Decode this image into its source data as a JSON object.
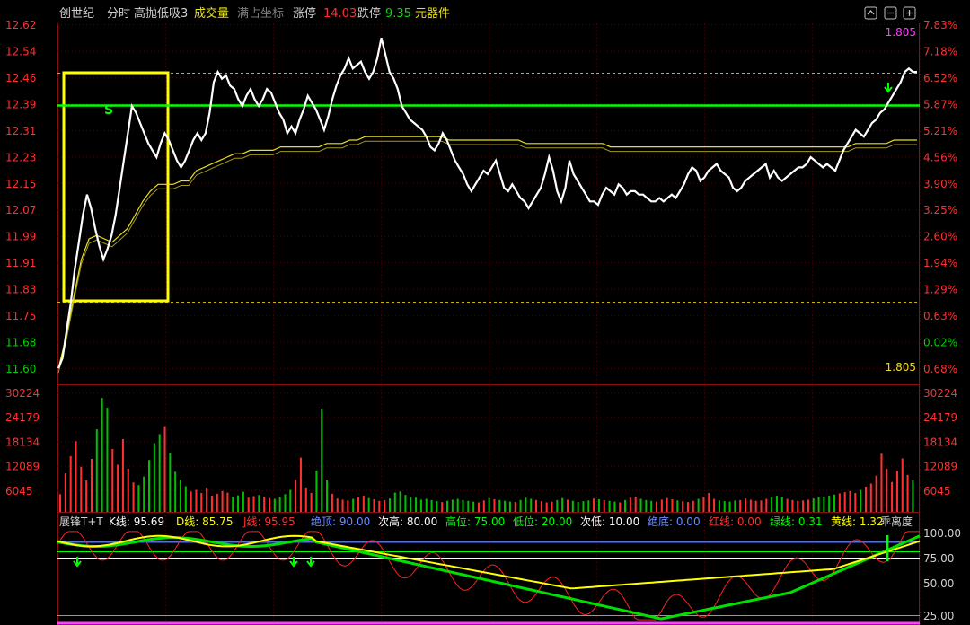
{
  "header": {
    "stock_name": "创世纪",
    "mode_label": "分时",
    "indicator_label": "高抛低吸3",
    "volume_label": "成交量",
    "coord_label": "满占坐标",
    "limit_up_label": "涨停",
    "limit_up_value": "14.03",
    "limit_down_label": "跌停",
    "limit_down_value": "9.35",
    "sector_label": "元器件",
    "icons": [
      "expand-icon",
      "minus-icon",
      "plus-icon"
    ]
  },
  "price_axis": {
    "left_ticks": [
      "12.62",
      "12.54",
      "12.46",
      "12.39",
      "12.31",
      "12.23",
      "12.15",
      "12.07",
      "11.99",
      "11.91",
      "11.83",
      "11.75",
      "11.68",
      "11.60"
    ],
    "right_ticks": [
      "7.83%",
      "7.18%",
      "6.52%",
      "5.87%",
      "5.21%",
      "4.56%",
      "3.90%",
      "3.25%",
      "2.60%",
      "1.94%",
      "1.29%",
      "0.63%",
      "0.02%",
      "0.68%"
    ],
    "top_right_value": "1.805",
    "bottom_right_value": "1.805"
  },
  "volume_axis": {
    "ticks": [
      "30224",
      "24179",
      "18134",
      "12089",
      "6045"
    ]
  },
  "indicator_bar": {
    "name": "展锋T+T",
    "items": [
      {
        "label": "K线:",
        "value": "95.69",
        "color": "#ffffff"
      },
      {
        "label": "D线:",
        "value": "85.75",
        "color": "#ffff00"
      },
      {
        "label": "J线:",
        "value": "95.95",
        "color": "#ff3030"
      },
      {
        "label": "绝顶:",
        "value": "90.00",
        "color": "#6a8cff"
      },
      {
        "label": "次高:",
        "value": "80.00",
        "color": "#ffffff"
      },
      {
        "label": "高位:",
        "value": "75.00",
        "color": "#00ff00"
      },
      {
        "label": "低位:",
        "value": "20.00",
        "color": "#00ff00"
      },
      {
        "label": "次低:",
        "value": "10.00",
        "color": "#ffffff"
      },
      {
        "label": "绝底:",
        "value": "0.00",
        "color": "#6a8cff"
      },
      {
        "label": "红线:",
        "value": "0.00",
        "color": "#ff3030"
      },
      {
        "label": "绿线:",
        "value": "0.31",
        "color": "#00ff00"
      },
      {
        "label": "黄线:",
        "value": "1.32",
        "color": "#ffff00"
      }
    ],
    "trailing_label": "乖离度"
  },
  "indicator_axis": {
    "ticks": [
      "100.00",
      "75.00",
      "50.00",
      "25.00"
    ]
  },
  "colors": {
    "up": "#ff3030",
    "down": "#00e000",
    "price_line": "#ffffff",
    "avg_line": "#e8e020",
    "box": "#ffff00",
    "support_line": "#00ff00"
  },
  "chart_data": {
    "type": "line",
    "price": [
      11.61,
      11.64,
      11.72,
      11.8,
      11.9,
      11.98,
      12.06,
      12.12,
      12.08,
      12.02,
      11.97,
      11.93,
      11.96,
      12.0,
      12.06,
      12.14,
      12.22,
      12.3,
      12.38,
      12.36,
      12.33,
      12.3,
      12.27,
      12.25,
      12.23,
      12.27,
      12.3,
      12.28,
      12.25,
      12.22,
      12.2,
      12.22,
      12.25,
      12.28,
      12.3,
      12.28,
      12.3,
      12.36,
      12.45,
      12.48,
      12.46,
      12.47,
      12.44,
      12.43,
      12.4,
      12.38,
      12.41,
      12.43,
      12.4,
      12.38,
      12.4,
      12.43,
      12.42,
      12.39,
      12.36,
      12.34,
      12.3,
      12.32,
      12.3,
      12.34,
      12.37,
      12.41,
      12.39,
      12.37,
      12.34,
      12.31,
      12.35,
      12.4,
      12.44,
      12.47,
      12.49,
      12.52,
      12.49,
      12.5,
      12.51,
      12.48,
      12.46,
      12.48,
      12.52,
      12.58,
      12.53,
      12.48,
      12.46,
      12.43,
      12.38,
      12.36,
      12.34,
      12.33,
      12.32,
      12.31,
      12.29,
      12.26,
      12.25,
      12.27,
      12.3,
      12.28,
      12.25,
      12.22,
      12.2,
      12.18,
      12.15,
      12.13,
      12.15,
      12.17,
      12.19,
      12.18,
      12.2,
      12.22,
      12.18,
      12.14,
      12.13,
      12.15,
      12.13,
      12.11,
      12.1,
      12.08,
      12.1,
      12.12,
      12.14,
      12.18,
      12.23,
      12.19,
      12.13,
      12.1,
      12.14,
      12.22,
      12.18,
      12.16,
      12.14,
      12.12,
      12.1,
      12.1,
      12.09,
      12.12,
      12.14,
      12.13,
      12.12,
      12.15,
      12.14,
      12.12,
      12.13,
      12.13,
      12.12,
      12.12,
      12.11,
      12.1,
      12.1,
      12.11,
      12.1,
      12.11,
      12.12,
      12.11,
      12.13,
      12.15,
      12.18,
      12.2,
      12.19,
      12.16,
      12.17,
      12.19,
      12.2,
      12.21,
      12.19,
      12.18,
      12.17,
      12.14,
      12.13,
      12.14,
      12.16,
      12.17,
      12.18,
      12.19,
      12.2,
      12.21,
      12.17,
      12.19,
      12.17,
      12.16,
      12.17,
      12.18,
      12.19,
      12.2,
      12.2,
      12.21,
      12.23,
      12.22,
      12.21,
      12.2,
      12.21,
      12.2,
      12.19,
      12.22,
      12.25,
      12.27,
      12.29,
      12.31,
      12.3,
      12.29,
      12.31,
      12.33,
      12.34,
      12.36,
      12.37,
      12.39,
      12.41,
      12.43,
      12.45,
      12.48,
      12.49,
      12.48,
      12.48
    ],
    "avg": [
      11.61,
      11.7,
      11.82,
      11.93,
      11.99,
      12.0,
      11.99,
      11.98,
      12.0,
      12.02,
      12.06,
      12.1,
      12.13,
      12.15,
      12.15,
      12.15,
      12.16,
      12.16,
      12.19,
      12.2,
      12.21,
      12.22,
      12.23,
      12.24,
      12.24,
      12.25,
      12.25,
      12.25,
      12.25,
      12.26,
      12.26,
      12.26,
      12.26,
      12.26,
      12.26,
      12.27,
      12.27,
      12.27,
      12.28,
      12.28,
      12.29,
      12.29,
      12.29,
      12.29,
      12.29,
      12.29,
      12.29,
      12.29,
      12.29,
      12.29,
      12.29,
      12.28,
      12.28,
      12.28,
      12.28,
      12.28,
      12.28,
      12.28,
      12.28,
      12.28,
      12.28,
      12.27,
      12.27,
      12.27,
      12.27,
      12.27,
      12.27,
      12.27,
      12.27,
      12.27,
      12.27,
      12.27,
      12.26,
      12.26,
      12.26,
      12.26,
      12.26,
      12.26,
      12.26,
      12.26,
      12.26,
      12.26,
      12.26,
      12.26,
      12.26,
      12.26,
      12.26,
      12.26,
      12.26,
      12.26,
      12.26,
      12.26,
      12.26,
      12.26,
      12.26,
      12.26,
      12.26,
      12.26,
      12.26,
      12.26,
      12.26,
      12.26,
      12.26,
      12.26,
      12.27,
      12.27,
      12.27,
      12.27,
      12.27,
      12.28,
      12.28,
      12.28,
      12.28
    ],
    "volume": [
      4500,
      9800,
      14200,
      18000,
      11500,
      8000,
      13500,
      21000,
      29000,
      26500,
      16000,
      12000,
      18500,
      11000,
      7500,
      6800,
      9000,
      13200,
      17500,
      19800,
      21800,
      15000,
      10200,
      8200,
      6500,
      5200,
      5600,
      4800,
      6200,
      4100,
      4600,
      5300,
      4900,
      3800,
      4200,
      5100,
      3600,
      4000,
      4300,
      3900,
      3500,
      3300,
      3700,
      4500,
      5600,
      8200,
      13800,
      6200,
      4800,
      10500,
      26300,
      8000,
      4600,
      3400,
      3100,
      2900,
      3300,
      3700,
      4100,
      3500,
      3200,
      2800,
      3000,
      3400,
      4900,
      5200,
      4300,
      3800,
      3600,
      3100,
      3300,
      3000,
      2700,
      2500,
      2800,
      3100,
      3300,
      3000,
      2800,
      2600,
      2400,
      2900,
      3500,
      3200,
      3000,
      2800,
      2600,
      2500,
      3000,
      3600,
      3300,
      3000,
      2700,
      2400,
      2600,
      3000,
      3500,
      3100,
      2800,
      2500,
      2700,
      2900,
      3400,
      3200,
      3000,
      2800,
      2600,
      2400,
      3000,
      3600,
      3900,
      3300,
      3000,
      2800,
      2600,
      3100,
      3500,
      3200,
      2900,
      2700,
      2500,
      2800,
      3300,
      3700,
      4800,
      3300,
      2900,
      2700,
      2600,
      2900,
      3000,
      3400,
      3100,
      2800,
      2900,
      3300,
      3700,
      4100,
      3800,
      3300,
      3000,
      2800,
      2900,
      3100,
      3400,
      3700,
      3900,
      4100,
      4400,
      4700,
      5000,
      5300,
      4800,
      5600,
      6400,
      7200,
      9200,
      14800,
      11000,
      7600,
      10400,
      13600,
      9400,
      8000
    ],
    "ylim": [
      11.6,
      12.62
    ],
    "volume_ylim": [
      0,
      32000
    ],
    "indicator_ylim": [
      0,
      105
    ]
  }
}
